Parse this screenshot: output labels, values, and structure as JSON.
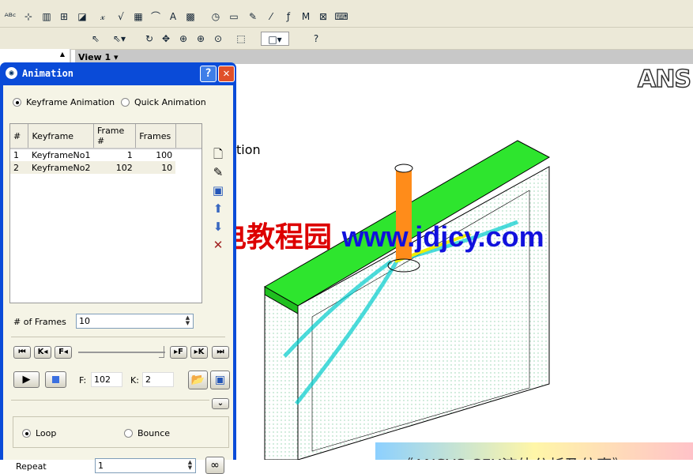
{
  "toolbar1": {
    "icons": [
      "text-abc-icon",
      "axis-icon",
      "legend-icon",
      "grid-icon",
      "clip-plane-icon",
      "expression-icon",
      "formula-icon",
      "table-icon",
      "chart-icon",
      "text-icon",
      "color-map-icon",
      "clock-icon",
      "film-icon",
      "edit-icon",
      "probe-icon",
      "function-icon",
      "macro-icon",
      "variable-icon",
      "command-icon"
    ]
  },
  "toolbar2": {
    "icons": [
      "select-icon",
      "pick-icon",
      "rotate-icon",
      "pan-icon",
      "zoom-box-icon",
      "zoom-icon",
      "zoom-fit-icon",
      "view-fit-icon",
      "viewport-layout-icon",
      "help-icon"
    ]
  },
  "view": {
    "title": "View 1",
    "logo": "ANS",
    "label_fragment": "tion"
  },
  "watermark": {
    "cn": "机电教程园",
    "url": "www.jdjcy.com"
  },
  "banner": "《ANSYS CFX流体分析及仿真》",
  "dialog": {
    "title": "Animation",
    "help": "?",
    "close": "✕",
    "mode_keyframe": "Keyframe Animation",
    "mode_quick": "Quick Animation",
    "selected_mode": "keyframe",
    "columns": [
      "#",
      "Keyframe",
      "Frame #",
      "Frames"
    ],
    "rows": [
      [
        "1",
        "KeyframeNo1",
        "1",
        "100"
      ],
      [
        "2",
        "KeyframeNo2",
        "102",
        "10"
      ]
    ],
    "frames_label": "# of Frames",
    "frames_value": "10",
    "nav": [
      "⏮",
      "K◂",
      "F◂",
      "▸F",
      "▸K",
      "⏭"
    ],
    "slider_value": 1.0,
    "f_label": "F:",
    "f_value": "102",
    "k_label": "K:",
    "k_value": "2",
    "loop": "Loop",
    "bounce": "Bounce",
    "selected_repeat_mode": "loop",
    "repeat_label": "Repeat",
    "repeat_value": "1",
    "infinite": "∞"
  },
  "colors": {
    "titlebar": "#0a4bd8",
    "plane": "#22dd22",
    "jet": "#ff8800",
    "streak": "#00bcd4"
  }
}
